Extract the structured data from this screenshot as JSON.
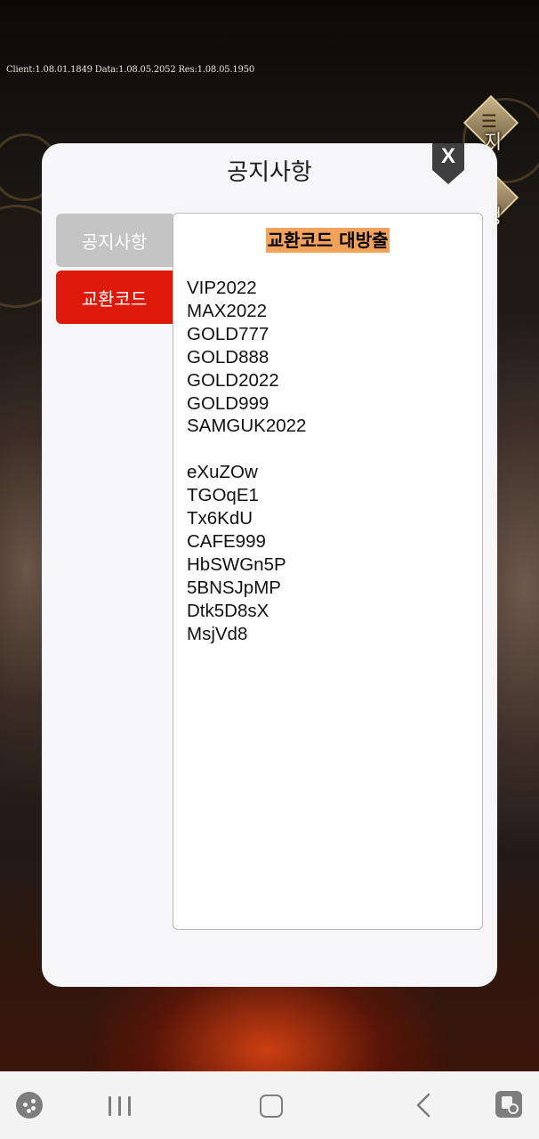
{
  "version_text": "Client:1.08.01.1849   Data:1.08.05.2052   Res:1.08.05.1950",
  "side_buttons": [
    {
      "icon": "scroll-emblem-icon",
      "caption_partial": "지"
    },
    {
      "icon": "sword-emblem-icon",
      "caption_partial": "정"
    }
  ],
  "modal": {
    "title": "공지사항",
    "close_label": "X",
    "tabs": [
      {
        "label": "공지사항",
        "active": false
      },
      {
        "label": "교환코드",
        "active": true
      }
    ],
    "content": {
      "headline": "교환코드 대방출",
      "codes_group_1": [
        "VIP2022",
        "MAX2022",
        "GOLD777",
        "GOLD888",
        "GOLD2022",
        "GOLD999",
        "SAMGUK2022"
      ],
      "codes_group_2": [
        "eXuZOw",
        "TGOqE1",
        "Tx6KdU",
        "CAFE999",
        "HbSWGn5P",
        "5BNSJpMP",
        "Dtk5D8sX",
        "MsjVd8"
      ]
    }
  },
  "colors": {
    "active_tab": "#dd1a0a",
    "inactive_tab": "#c4c4c4",
    "headline_highlight": "#f2a25b"
  },
  "navbar": {
    "items": [
      "game-launcher-icon",
      "recent-apps-icon",
      "home-icon",
      "back-icon",
      "game-tools-icon"
    ]
  }
}
